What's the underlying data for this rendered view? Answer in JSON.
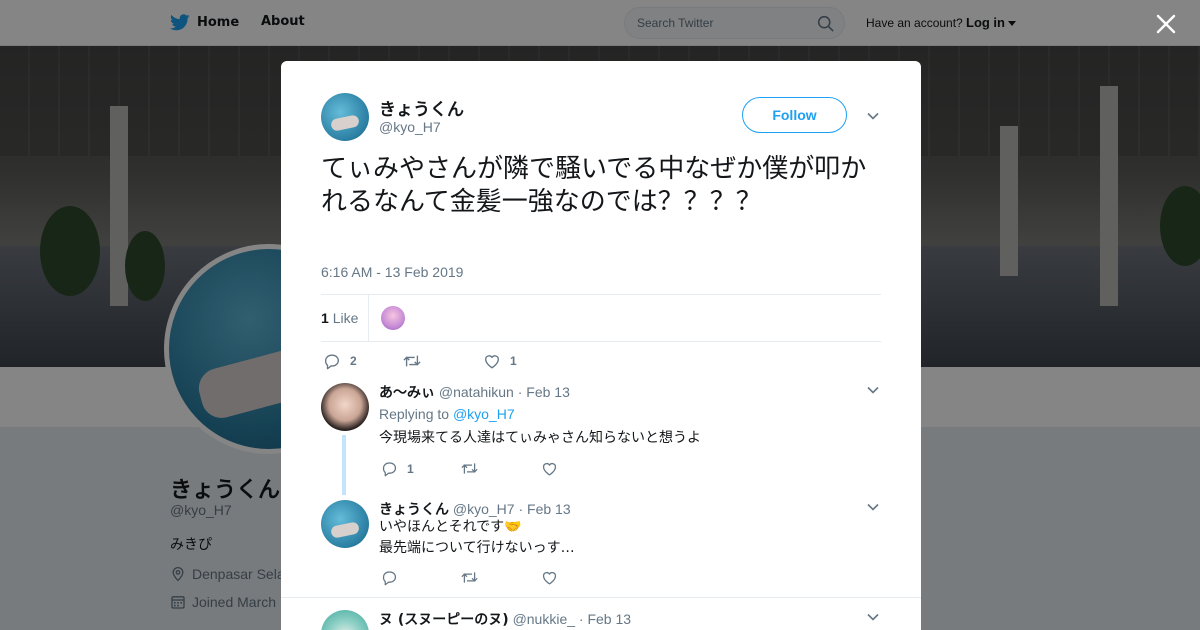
{
  "topbar": {
    "home_label": "Home",
    "about_label": "About",
    "search_placeholder": "Search Twitter",
    "account_prompt": "Have an account?",
    "login_label": "Log in"
  },
  "profile": {
    "name": "きょうくん",
    "handle": "@kyo_H7",
    "bio": "みきぴ",
    "location": "Denpasar Sela",
    "joined": "Joined March"
  },
  "tweet": {
    "author_name": "きょうくん",
    "author_handle": "@kyo_H7",
    "follow_label": "Follow",
    "text": "てぃみやさんが隣で騒いでる中なぜか僕が叩かれるなんて金髪一強なのでは？？？？",
    "timestamp": "6:16 AM - 13 Feb 2019",
    "likes_count": "1",
    "likes_label": "Like",
    "reply_count": "2",
    "retweet_count": "",
    "like_action_count": "1"
  },
  "replies": [
    {
      "name": "あ〜みぃ",
      "handle": "@natahikun",
      "date": "· Feb 13",
      "replying_prefix": "Replying to",
      "replying_to": "@kyo_H7",
      "text": "今現場来てる人達はてぃみゃさん知らないと想うよ",
      "reply_count": "1"
    },
    {
      "name": "きょうくん",
      "handle": "@kyo_H7",
      "date": "· Feb 13",
      "text_line1": "いやほんとそれです",
      "emoji": "🤝",
      "text_line2": "最先端について行けないっす…"
    },
    {
      "name": "ヌ (スヌーピーのヌ)",
      "handle": "@nukkie_",
      "date": "· Feb 13"
    }
  ],
  "colors": {
    "accent": "#1da1f2",
    "text_primary": "#14171a",
    "text_secondary": "#657786",
    "thread_line": "#c4e4fc"
  }
}
